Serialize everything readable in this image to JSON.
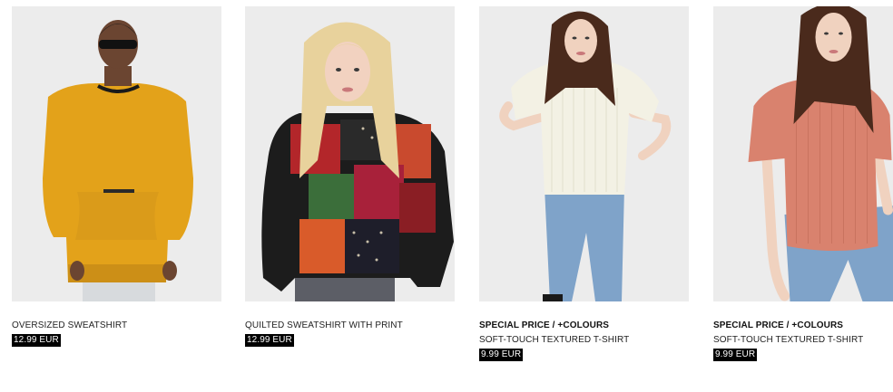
{
  "products": [
    {
      "promo": "",
      "name": "OVERSIZED SWEATSHIRT",
      "price": "12.99 EUR",
      "image": "model-in-mustard-yellow-oversized-sweatshirt"
    },
    {
      "promo": "",
      "name": "QUILTED SWEATSHIRT WITH PRINT",
      "price": "12.99 EUR",
      "image": "model-in-red-black-floral-patchwork-sweatshirt"
    },
    {
      "promo": "SPECIAL PRICE / +COLOURS",
      "name": "SOFT-TOUCH TEXTURED T-SHIRT",
      "price": "9.99 EUR",
      "image": "model-in-cream-textured-tshirt-and-jeans"
    },
    {
      "promo": "SPECIAL PRICE / +COLOURS",
      "name": "SOFT-TOUCH TEXTURED T-SHIRT",
      "price": "9.99 EUR",
      "image": "model-in-coral-textured-tshirt-and-jeans"
    }
  ],
  "colors": {
    "photo_bg": "#ececec",
    "price_bg": "#000000",
    "price_text": "#ffffff",
    "yellow": "#e3a21a",
    "cream": "#f3f1e4",
    "coral": "#d9826e",
    "denim": "#7fa3c9"
  }
}
